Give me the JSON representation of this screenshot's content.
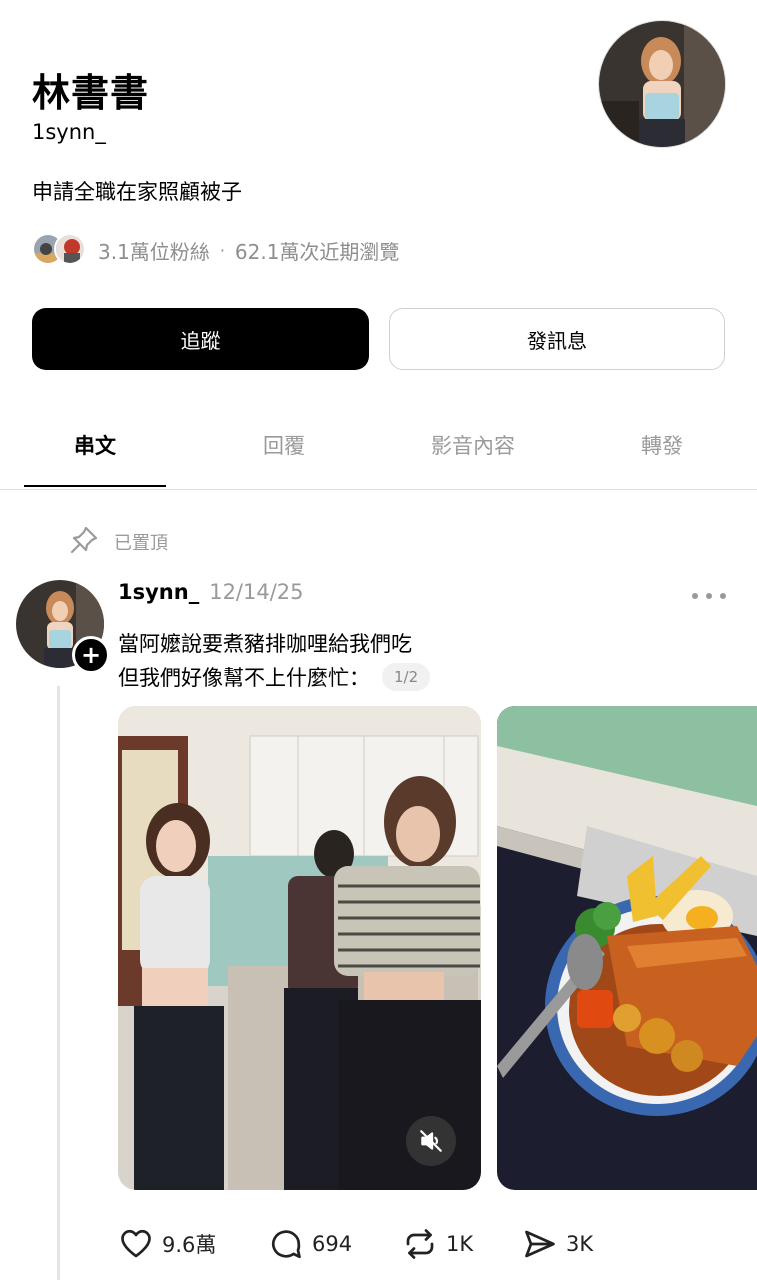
{
  "profile": {
    "name": "林書書",
    "handle": "1synn_",
    "bio": "申請全職在家照顧被子",
    "followers": "3.1萬位粉絲",
    "separator": "·",
    "views": "62.1萬次近期瀏覽"
  },
  "buttons": {
    "follow": "追蹤",
    "message": "發訊息"
  },
  "tabs": [
    "串文",
    "回覆",
    "影音內容",
    "轉發"
  ],
  "post": {
    "pinned_label": "已置頂",
    "username": "1synn_",
    "date": "12/14/25",
    "text_line1": "當阿嬤說要煮豬排咖哩給我們吃",
    "text_line2": "但我們好像幫不上什麼忙：",
    "translate_badge": "1/2",
    "likes": "9.6萬",
    "comments": "694",
    "reposts": "1K",
    "shares": "3K"
  },
  "colors": {
    "text_primary": "#000000",
    "text_secondary": "#9a9a9a",
    "follow_button": "#000000",
    "divider": "#e0e0e0"
  }
}
